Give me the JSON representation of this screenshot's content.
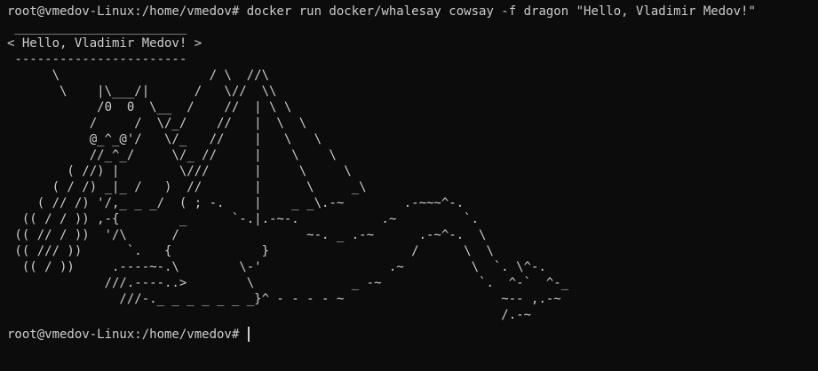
{
  "terminal": {
    "command_line": "root@vmedov-Linux:/home/vmedov# docker run docker/whalesay cowsay -f dragon \"Hello, Vladimir Medov!\"",
    "output_lines": [
      " _______________________",
      "< Hello, Vladimir Medov! >",
      " -----------------------",
      "      \\                    / \\  //\\",
      "       \\    |\\___/|      /   \\//  \\\\",
      "            /0  0  \\__  /    //  | \\ \\",
      "           /     /  \\/_/    //   |  \\  \\",
      "           @_^_@'/   \\/_   //    |   \\   \\",
      "           //_^_/     \\/_ //     |    \\    \\",
      "        ( //) |        \\///      |     \\     \\",
      "      ( / /) _|_ /   )  //       |      \\     _\\",
      "    ( // /) '/,_ _ _/  ( ; -.    |    _ _\\.-~        .-~~~^-.",
      "  (( / / )) ,-{        _      `-.|.-~-.           .~         `.",
      " (( // / ))  '/\\      /                 ~-. _ .-~      .-~^-.  \\",
      " (( /// ))      `.   {            }                   /      \\  \\",
      "  (( / ))     .----~-.\\        \\-'                 .~         \\  `. \\^-.",
      "             ///.----..>        \\             _ -~             `.  ^-`  ^-_",
      "               ///-._ _ _ _ _ _ _}^ - - - - ~                     ~-- ,.-~",
      "                                                                  /.-~"
    ],
    "prompt": "root@vmedov-Linux:/home/vmedov# "
  },
  "colors": {
    "background": "#0c0c0c",
    "foreground": "#cccccc"
  }
}
